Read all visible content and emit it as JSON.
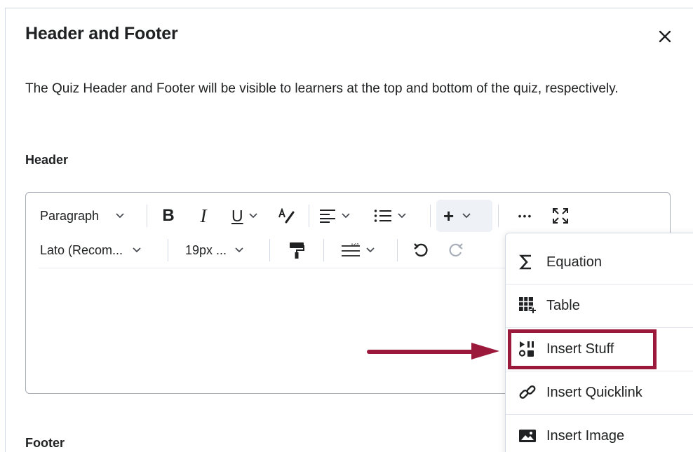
{
  "dialog": {
    "title": "Header and Footer",
    "close_icon": "close-icon",
    "description": "The Quiz Header and Footer will be visible to learners at the top and bottom of the quiz, respectively.",
    "header_label": "Header",
    "footer_label": "Footer"
  },
  "toolbar": {
    "paragraph": "Paragraph",
    "bold": "B",
    "italic": "I",
    "underline": "U",
    "font": "Lato (Recom...",
    "size": "19px ...",
    "plus": "+",
    "more": "•••"
  },
  "insert_menu": {
    "items": [
      {
        "label": "Equation",
        "icon": "sigma-icon"
      },
      {
        "label": "Table",
        "icon": "table-icon"
      },
      {
        "label": "Insert Stuff",
        "icon": "insert-stuff-icon"
      },
      {
        "label": "Insert Quicklink",
        "icon": "link-icon"
      },
      {
        "label": "Insert Image",
        "icon": "image-icon"
      }
    ]
  },
  "colors": {
    "highlight": "#9b1a3c",
    "text": "#202122",
    "border": "#a8aeb8"
  }
}
